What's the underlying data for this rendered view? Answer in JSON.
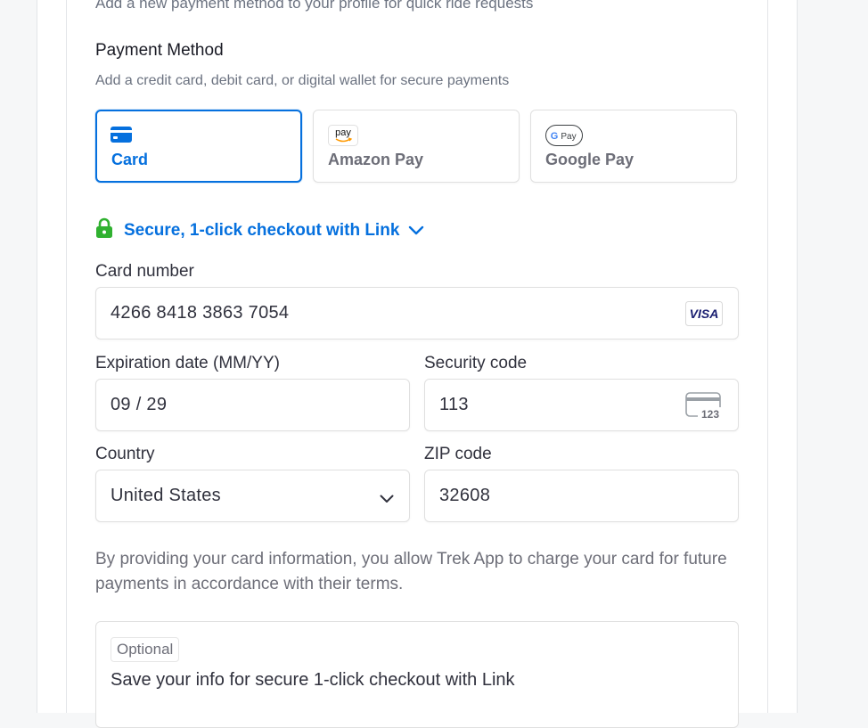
{
  "header": {
    "subtitle": "Add a new payment method to your profile for quick ride requests"
  },
  "payment_section": {
    "title": "Payment Method",
    "description": "Add a credit card, debit card, or digital wallet for secure payments"
  },
  "tabs": [
    {
      "label": "Card",
      "icon": "card-icon",
      "selected": true
    },
    {
      "label": "Amazon Pay",
      "icon": "amazon-pay-icon",
      "icon_text": "pay",
      "selected": false
    },
    {
      "label": "Google Pay",
      "icon": "google-pay-icon",
      "icon_text": "Pay",
      "selected": false
    }
  ],
  "link": {
    "text": "Secure, 1-click checkout with Link",
    "icon": "lock-icon"
  },
  "fields": {
    "card_number": {
      "label": "Card number",
      "value": "4266 8418 3863 7054",
      "brand": "VISA"
    },
    "expiration": {
      "label": "Expiration date (MM/YY)",
      "value": "09 / 29"
    },
    "security_code": {
      "label": "Security code",
      "value": "113",
      "icon_text": "123"
    },
    "country": {
      "label": "Country",
      "value": "United States"
    },
    "zip": {
      "label": "ZIP code",
      "value": "32608"
    }
  },
  "legal_text": "By providing your card information, you allow Trek App to charge your card for future payments in accordance with their terms.",
  "save_info": {
    "badge": "Optional",
    "text": "Save your info for secure 1-click checkout with Link"
  },
  "colors": {
    "accent": "#0570de",
    "lock_green": "#30b130",
    "muted_text": "#6d6e78"
  }
}
